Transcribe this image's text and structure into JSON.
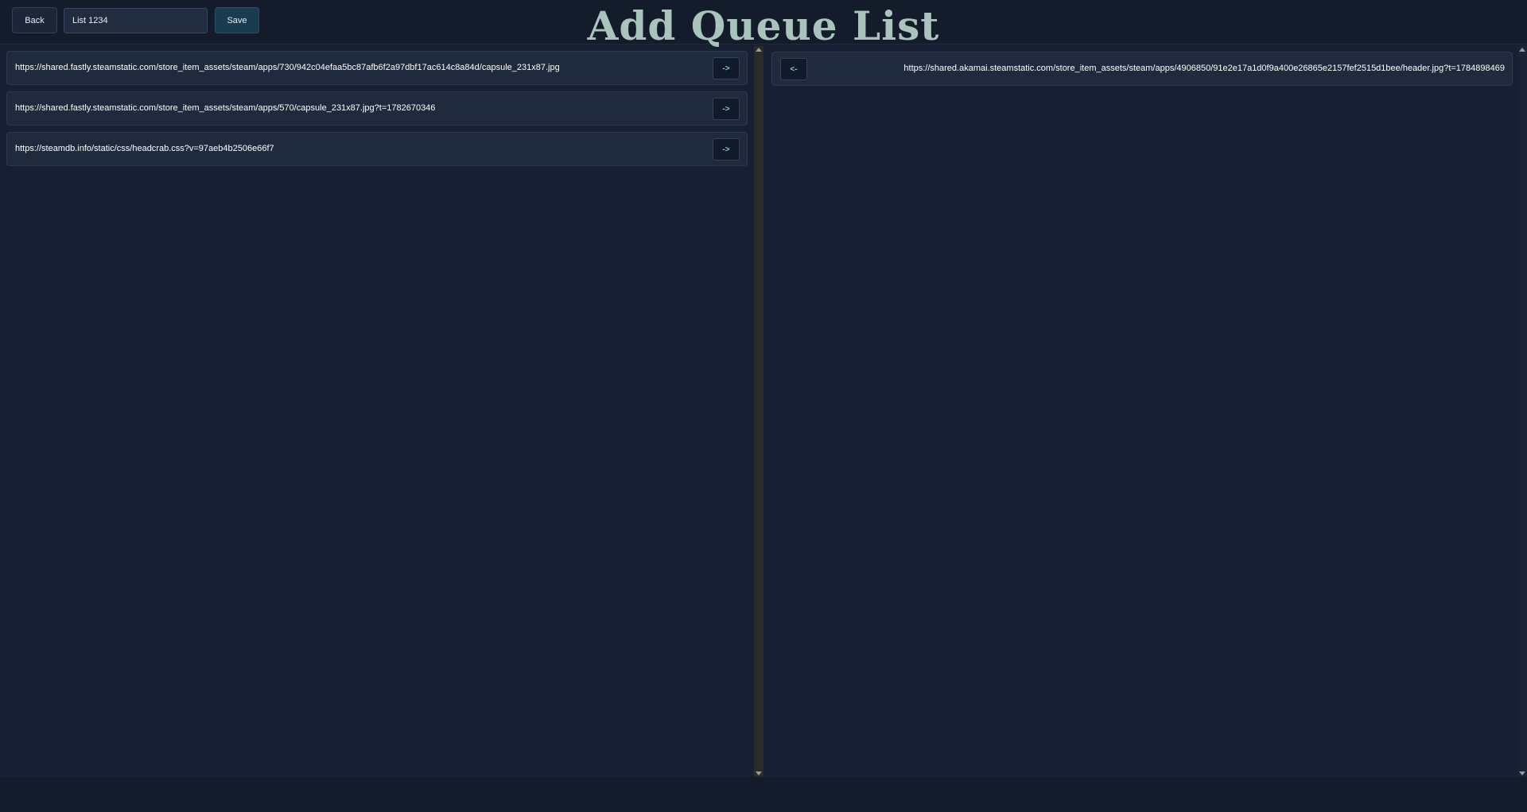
{
  "header": {
    "back_label": "Back",
    "list_name_value": "List 1234",
    "save_label": "Save",
    "title": "Add Queue List"
  },
  "available": {
    "items": [
      {
        "url": "https://shared.fastly.steamstatic.com/store_item_assets/steam/apps/730/942c04efaa5bc87afb6f2a97dbf17ac614c8a84d/capsule_231x87.jpg",
        "action": "->"
      },
      {
        "url": "https://shared.fastly.steamstatic.com/store_item_assets/steam/apps/570/capsule_231x87.jpg?t=1782670346",
        "action": "->"
      },
      {
        "url": "https://steamdb.info/static/css/headcrab.css?v=97aeb4b2506e66f7",
        "action": "->"
      }
    ]
  },
  "queued": {
    "items": [
      {
        "url": "https://shared.akamai.steamstatic.com/store_item_assets/steam/apps/4906850/91e2e17a1d0f9a400e26865e2157fef2515d1bee/header.jpg?t=1784898469",
        "action": "<-"
      }
    ]
  },
  "colors": {
    "background": "#172033",
    "title": "#a9c4bb",
    "accent": "#8fc4e0"
  }
}
